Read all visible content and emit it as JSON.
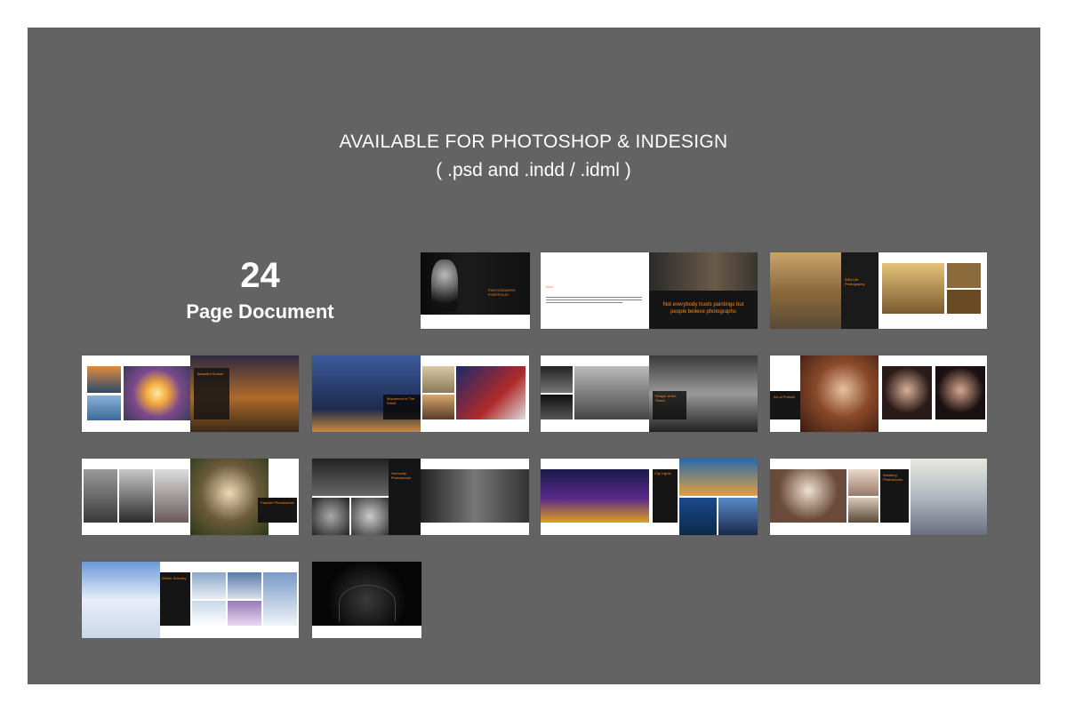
{
  "header": {
    "line1": "AVAILABLE FOR PHOTOSHOP & INDESIGN",
    "line2": "( .psd and .indd / .idml )"
  },
  "pages": {
    "count": "24",
    "label": "Page Document"
  },
  "spreads": [
    {
      "title": "PHOTOGRAPHY PORTFOLIO"
    },
    {
      "title": "Intro",
      "quote": "Not everybody trusts paintings but people believe photographs"
    },
    {
      "title": "Wild Life Photography"
    },
    {
      "title": "Beautiful Sunset"
    },
    {
      "title": "Monument of The World"
    },
    {
      "title": "People of the Street"
    },
    {
      "title": "Art of Portrait"
    },
    {
      "title": "Fashion Photoshoots"
    },
    {
      "title": "Humanity Photoshoots"
    },
    {
      "title": "City Lights"
    },
    {
      "title": "Wedding Photoshoots"
    },
    {
      "title": "Winter Scenery"
    },
    {
      "title": ""
    }
  ],
  "colors": {
    "panel": "#636363",
    "accent": "#ff8a1e"
  }
}
